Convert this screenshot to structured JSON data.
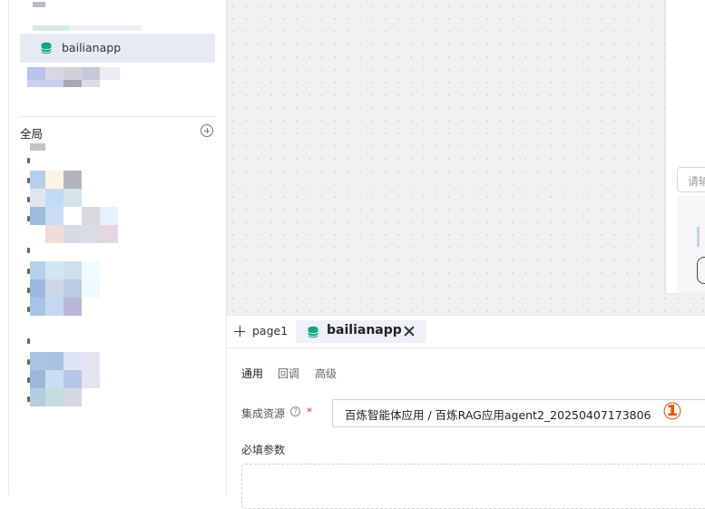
{
  "sidebar": {
    "resource_item": {
      "label": "bailianapp",
      "icon": "database-icon"
    },
    "global_section": {
      "title": "全局",
      "add_icon": "add-circle-icon"
    }
  },
  "preview": {
    "search_placeholder": "请输"
  },
  "panel": {
    "tabs": [
      {
        "label": "page1",
        "active": false
      },
      {
        "label": "bailianapp",
        "active": true,
        "icon": "database-icon"
      }
    ],
    "subtabs": [
      "通用",
      "回调",
      "高级"
    ],
    "form": {
      "resource_label": "集成资源",
      "required_mark": "*",
      "resource_value": "百炼智能体应用 / 百炼RAG应用agent2_20250407173806",
      "annotation": "①",
      "required_params_label": "必填参数"
    }
  },
  "colors": {
    "accent_icon": "#0fa37f",
    "annotation": "#e8540c",
    "required": "#e0302d"
  }
}
